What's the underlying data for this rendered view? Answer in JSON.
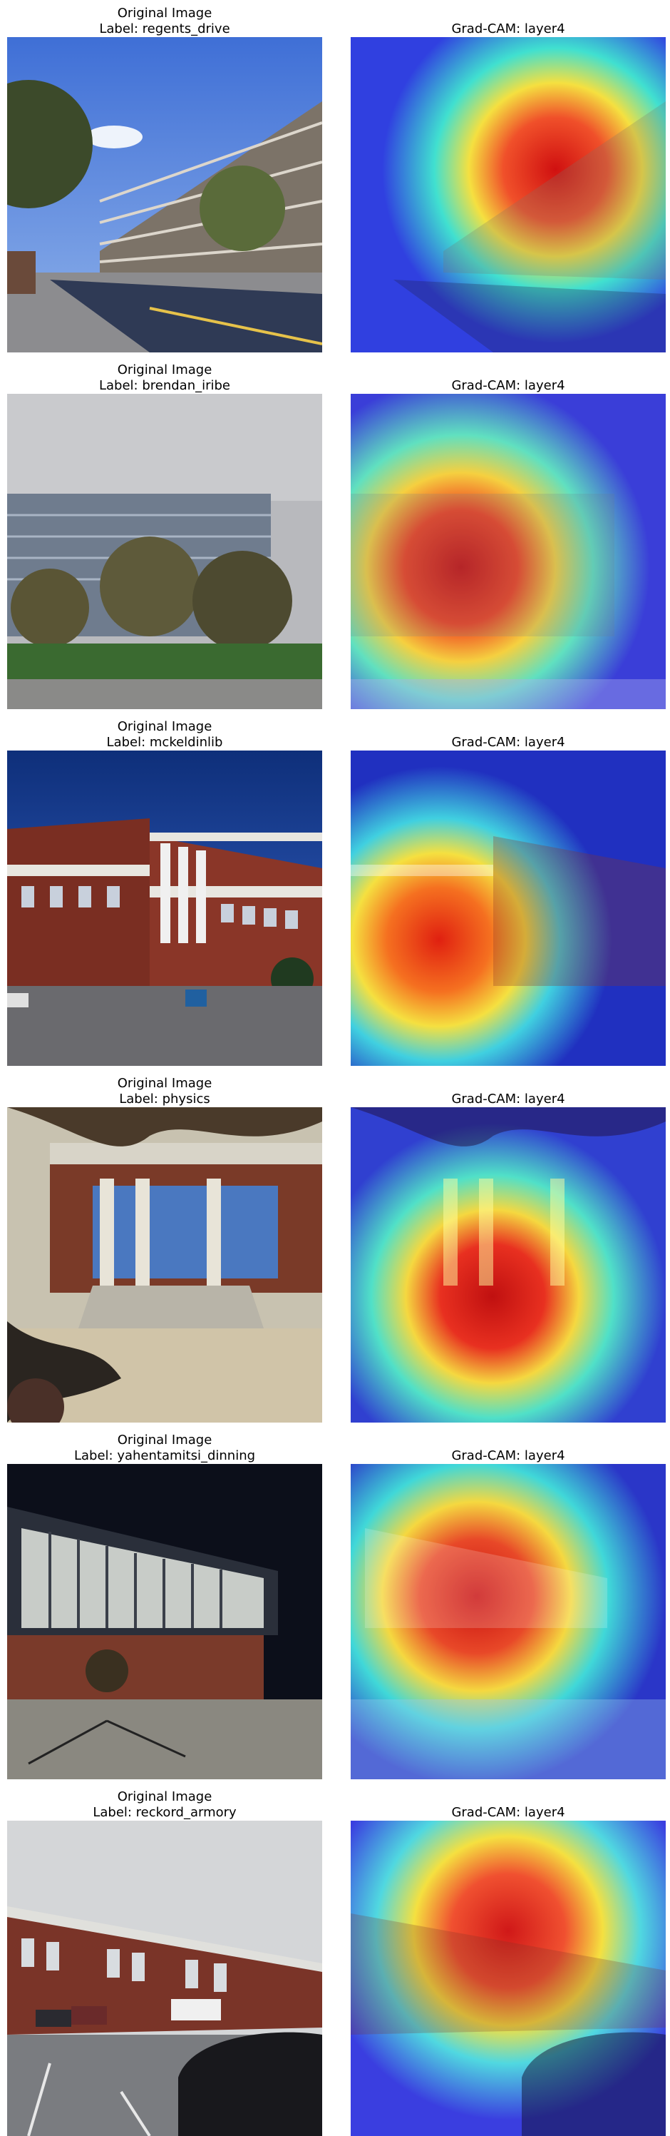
{
  "rows": [
    {
      "original_title": "Original Image",
      "label_text": "Label: regents_drive",
      "gradcam_title": "Grad-CAM: layer4",
      "scene": "parking-garage"
    },
    {
      "original_title": "Original Image",
      "label_text": "Label: brendan_iribe",
      "gradcam_title": "Grad-CAM: layer4",
      "scene": "glass-building-trees"
    },
    {
      "original_title": "Original Image",
      "label_text": "Label: mckeldinlib",
      "gradcam_title": "Grad-CAM: layer4",
      "scene": "brick-library"
    },
    {
      "original_title": "Original Image",
      "label_text": "Label: physics",
      "gradcam_title": "Grad-CAM: layer4",
      "scene": "brick-columns-stairs"
    },
    {
      "original_title": "Original Image",
      "label_text": "Label: yahentamitsi_dinning",
      "gradcam_title": "Grad-CAM: layer4",
      "scene": "dining-hall-night"
    },
    {
      "original_title": "Original Image",
      "label_text": "Label: reckord_armory",
      "gradcam_title": "Grad-CAM: layer4",
      "scene": "armory-parking-lot"
    }
  ]
}
